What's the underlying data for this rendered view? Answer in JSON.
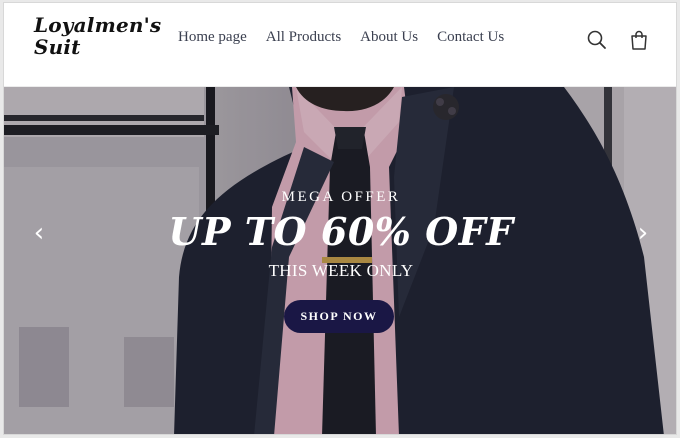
{
  "brand": {
    "line1": "Loyalmen's",
    "line2": "Suit"
  },
  "nav": {
    "items": [
      {
        "label": "Home page"
      },
      {
        "label": "All Products"
      },
      {
        "label": "About Us"
      },
      {
        "label": "Contact Us"
      }
    ]
  },
  "header_icons": {
    "search": "search-icon",
    "cart": "shopping-bag-icon"
  },
  "hero": {
    "eyebrow": "MEGA OFFER",
    "headline": "UP TO 60% OFF",
    "subheadline": "THIS WEEK ONLY",
    "cta_label": "SHOP NOW",
    "prev_glyph": "‹",
    "next_glyph": "›"
  },
  "colors": {
    "cta_background": "#1a1745",
    "nav_text": "#3b4050",
    "hero_text": "#ffffff",
    "suit": "#1e2230",
    "shirt": "#e7b9c6"
  }
}
